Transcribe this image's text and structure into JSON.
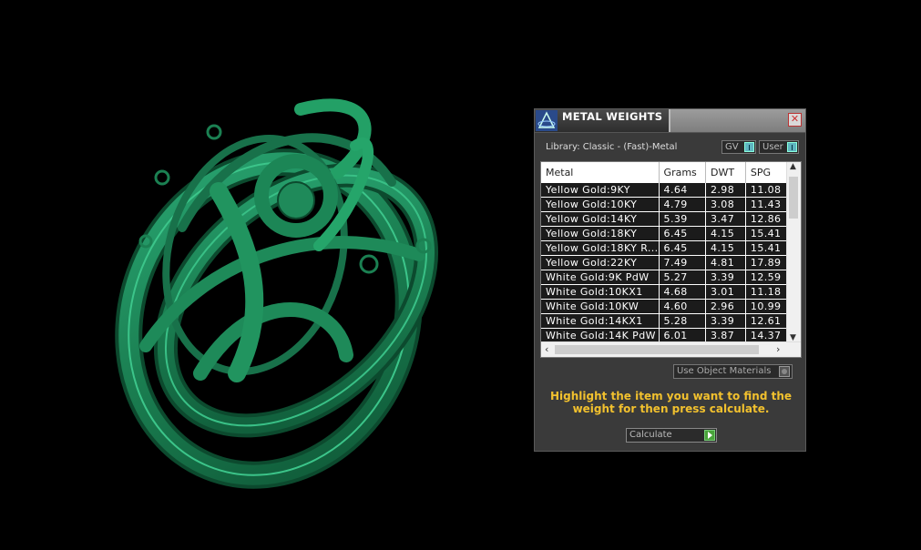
{
  "panel": {
    "title": "METAL WEIGHTS",
    "library_label": "Library: Classic - (Fast)-Metal",
    "toggle_gv": "GV",
    "toggle_user": "User",
    "use_object_materials": "Use Object Materials",
    "instruction": "Highlight the item you want to find the weight for then press calculate.",
    "calculate_label": "Calculate"
  },
  "table": {
    "columns": [
      "Metal",
      "Grams",
      "DWT",
      "SPG"
    ],
    "rows": [
      [
        "Yellow Gold:9KY",
        "4.64",
        "2.98",
        "11.08"
      ],
      [
        "Yellow Gold:10KY",
        "4.79",
        "3.08",
        "11.43"
      ],
      [
        "Yellow Gold:14KY",
        "5.39",
        "3.47",
        "12.86"
      ],
      [
        "Yellow Gold:18KY",
        "6.45",
        "4.15",
        "15.41"
      ],
      [
        "Yellow Gold:18KY R...",
        "6.45",
        "4.15",
        "15.41"
      ],
      [
        "Yellow Gold:22KY",
        "7.49",
        "4.81",
        "17.89"
      ],
      [
        "White Gold:9K PdW",
        "5.27",
        "3.39",
        "12.59"
      ],
      [
        "White Gold:10KX1",
        "4.68",
        "3.01",
        "11.18"
      ],
      [
        "White Gold:10KW",
        "4.60",
        "2.96",
        "10.99"
      ],
      [
        "White Gold:14KX1",
        "5.28",
        "3.39",
        "12.61"
      ],
      [
        "White Gold:14K PdW",
        "6.01",
        "3.87",
        "14.37"
      ]
    ]
  },
  "colors": {
    "ring": "#1f8a5a",
    "accent_text": "#f2c12e",
    "toggle_on": "#5fb5c0",
    "calc_go": "#49a33a"
  },
  "icons": {
    "logo": "pyramid-logo-icon",
    "close": "close-icon",
    "calc": "play-icon"
  }
}
